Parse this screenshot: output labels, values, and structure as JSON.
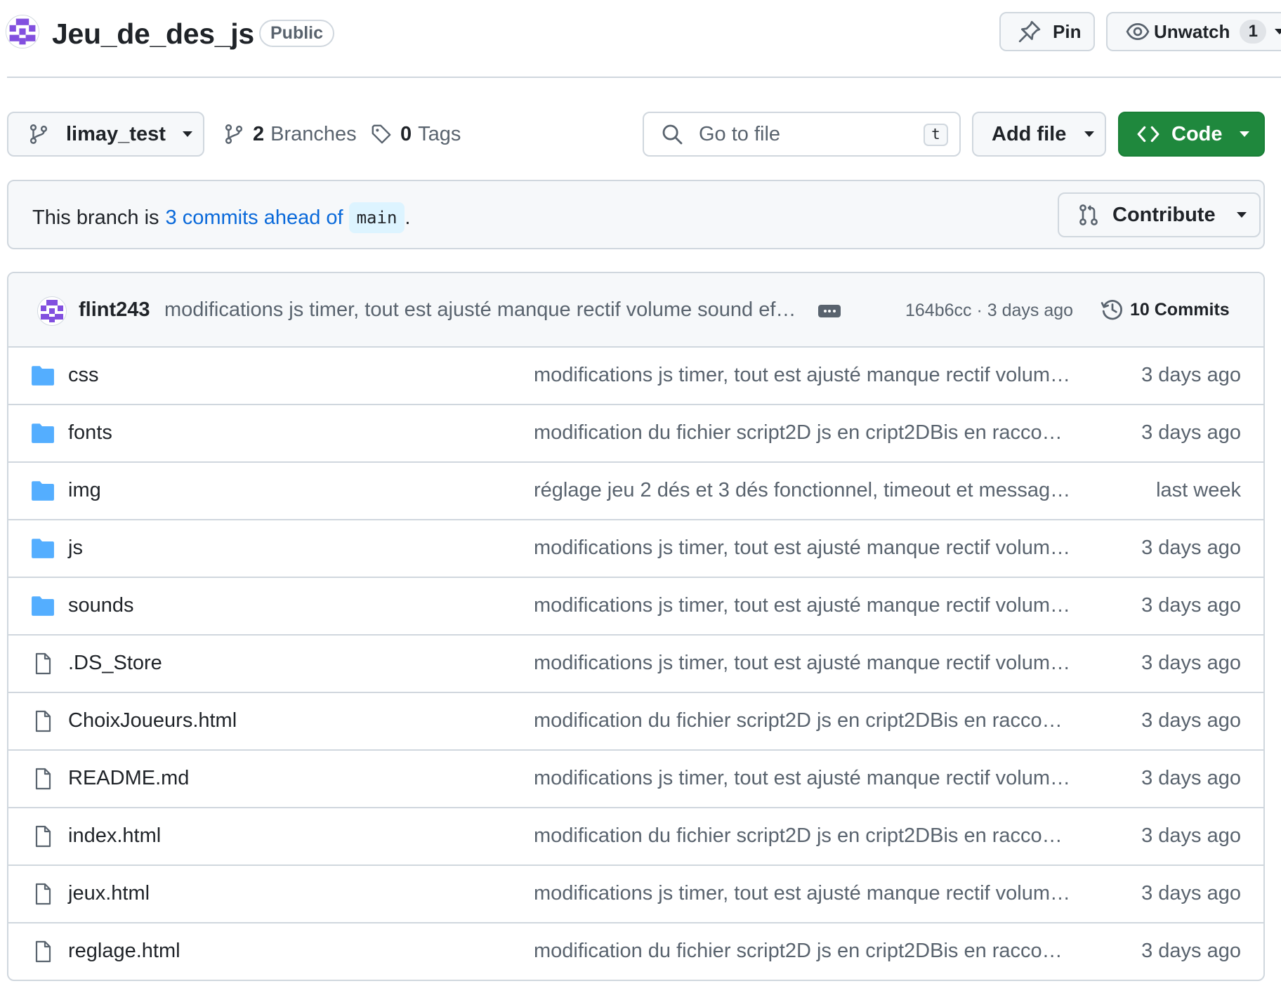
{
  "repo": {
    "name": "Jeu_de_des_js",
    "visibility": "Public",
    "pin_label": "Pin",
    "watch_label": "Unwatch",
    "watch_count": "1"
  },
  "toolbar": {
    "branch": "limay_test",
    "branches_count": "2",
    "branches_label": "Branches",
    "tags_count": "0",
    "tags_label": "Tags",
    "search_placeholder": "Go to file",
    "search_shortcut": "t",
    "add_file_label": "Add file",
    "code_label": "Code"
  },
  "banner": {
    "prefix": "This branch is",
    "link": "3 commits ahead of",
    "base": "main",
    "suffix": ".",
    "contribute_label": "Contribute"
  },
  "latest_commit": {
    "author": "flint243",
    "message": "modifications js timer, tout est ajusté manque rectif volume sound ef…",
    "meta": "164b6cc · 3 days ago",
    "commits_label": "10 Commits"
  },
  "files": [
    {
      "name": "css",
      "type": "folder",
      "message": "modifications js timer, tout est ajusté manque rectif volum…",
      "date": "3 days ago"
    },
    {
      "name": "fonts",
      "type": "folder",
      "message": "modification du fichier script2D js en cript2DBis en racco…",
      "date": "3 days ago"
    },
    {
      "name": "img",
      "type": "folder",
      "message": "réglage jeu 2 dés et 3 dés fonctionnel, timeout et messag…",
      "date": "last week"
    },
    {
      "name": "js",
      "type": "folder",
      "message": "modifications js timer, tout est ajusté manque rectif volum…",
      "date": "3 days ago"
    },
    {
      "name": "sounds",
      "type": "folder",
      "message": "modifications js timer, tout est ajusté manque rectif volum…",
      "date": "3 days ago"
    },
    {
      "name": ".DS_Store",
      "type": "file",
      "message": "modifications js timer, tout est ajusté manque rectif volum…",
      "date": "3 days ago"
    },
    {
      "name": "ChoixJoueurs.html",
      "type": "file",
      "message": "modification du fichier script2D js en cript2DBis en racco…",
      "date": "3 days ago"
    },
    {
      "name": "README.md",
      "type": "file",
      "message": "modifications js timer, tout est ajusté manque rectif volum…",
      "date": "3 days ago"
    },
    {
      "name": "index.html",
      "type": "file",
      "message": "modification du fichier script2D js en cript2DBis en racco…",
      "date": "3 days ago"
    },
    {
      "name": "jeux.html",
      "type": "file",
      "message": "modifications js timer, tout est ajusté manque rectif volum…",
      "date": "3 days ago"
    },
    {
      "name": "reglage.html",
      "type": "file",
      "message": "modification du fichier script2D js en cript2DBis en racco…",
      "date": "3 days ago"
    }
  ],
  "colors": {
    "accent_link": "#0969da",
    "code_button": "#1f883d",
    "folder_icon": "#54aeff",
    "avatar": "#8250df"
  }
}
